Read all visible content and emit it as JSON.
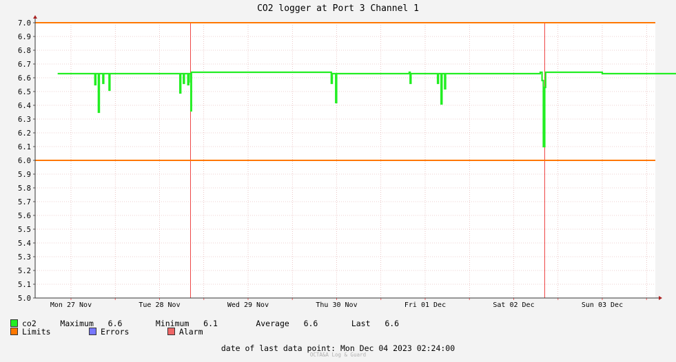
{
  "chart_data": {
    "type": "line",
    "title": "CO2 logger at Port 3 Channel 1",
    "xlabel": "",
    "ylabel": "",
    "ylim": [
      5.0,
      7.0
    ],
    "yticks": [
      "5.0",
      "5.1",
      "5.2",
      "5.3",
      "5.4",
      "5.5",
      "5.6",
      "5.7",
      "5.8",
      "5.9",
      "6.0",
      "6.1",
      "6.2",
      "6.3",
      "6.4",
      "6.5",
      "6.6",
      "6.7",
      "6.8",
      "6.9",
      "7.0"
    ],
    "x_categories": [
      "Mon 27 Nov",
      "Tue 28 Nov",
      "Wed 29 Nov",
      "Thu 30 Nov",
      "Fri 01 Dec",
      "Sat 02 Dec",
      "Sun 03 Dec"
    ],
    "grid": true,
    "limits": [
      6.0,
      7.0
    ],
    "alarm_events_day": [
      1.35,
      5.35
    ],
    "series": [
      {
        "name": "co2",
        "color": "#22ee22",
        "baseline": 6.63,
        "points": [
          [
            -0.15,
            6.63
          ],
          [
            0.26,
            6.63
          ],
          [
            0.27,
            6.55
          ],
          [
            0.28,
            6.63
          ],
          [
            0.3,
            6.63
          ],
          [
            0.31,
            6.35
          ],
          [
            0.32,
            6.63
          ],
          [
            0.35,
            6.63
          ],
          [
            0.36,
            6.56
          ],
          [
            0.37,
            6.63
          ],
          [
            0.42,
            6.63
          ],
          [
            0.43,
            6.51
          ],
          [
            0.44,
            6.63
          ],
          [
            1.22,
            6.63
          ],
          [
            1.23,
            6.49
          ],
          [
            1.24,
            6.63
          ],
          [
            1.26,
            6.63
          ],
          [
            1.27,
            6.56
          ],
          [
            1.28,
            6.63
          ],
          [
            1.31,
            6.63
          ],
          [
            1.32,
            6.55
          ],
          [
            1.33,
            6.63
          ],
          [
            1.34,
            6.63
          ],
          [
            1.35,
            6.57
          ],
          [
            1.355,
            6.36
          ],
          [
            1.36,
            6.64
          ],
          [
            2.0,
            6.64
          ],
          [
            2.5,
            6.64
          ],
          [
            2.93,
            6.64
          ],
          [
            2.94,
            6.56
          ],
          [
            2.95,
            6.63
          ],
          [
            2.98,
            6.63
          ],
          [
            2.99,
            6.42
          ],
          [
            3.0,
            6.63
          ],
          [
            3.82,
            6.64
          ],
          [
            3.83,
            6.56
          ],
          [
            3.84,
            6.63
          ],
          [
            4.13,
            6.63
          ],
          [
            4.14,
            6.56
          ],
          [
            4.15,
            6.63
          ],
          [
            4.17,
            6.63
          ],
          [
            4.18,
            6.41
          ],
          [
            4.19,
            6.63
          ],
          [
            4.21,
            6.63
          ],
          [
            4.22,
            6.52
          ],
          [
            4.23,
            6.63
          ],
          [
            5.3,
            6.64
          ],
          [
            5.32,
            6.58
          ],
          [
            5.335,
            6.1
          ],
          [
            5.35,
            6.53
          ],
          [
            5.36,
            6.64
          ],
          [
            6.0,
            6.63
          ],
          [
            6.5,
            6.63
          ],
          [
            6.85,
            6.63
          ]
        ]
      }
    ]
  },
  "legend": {
    "row1": {
      "series_label": "co2",
      "maximum_label": "Maximum",
      "maximum_value": "6.6",
      "minimum_label": "Minimum",
      "minimum_value": "6.1",
      "average_label": "Average",
      "average_value": "6.6",
      "last_label": "Last",
      "last_value": "6.6"
    },
    "row2": {
      "limits_label": "Limits",
      "errors_label": "Errors",
      "alarm_label": "Alarm"
    },
    "colors": {
      "co2": "#22ee22",
      "limits": "#ff7700",
      "errors": "#7777ff",
      "alarm": "#ee6666"
    }
  },
  "footer": {
    "last_point_label": "date of last data point:",
    "last_point_value": "Mon Dec 04 2023 02:24:00",
    "watermark": "OCTA&A Log & Guard"
  }
}
